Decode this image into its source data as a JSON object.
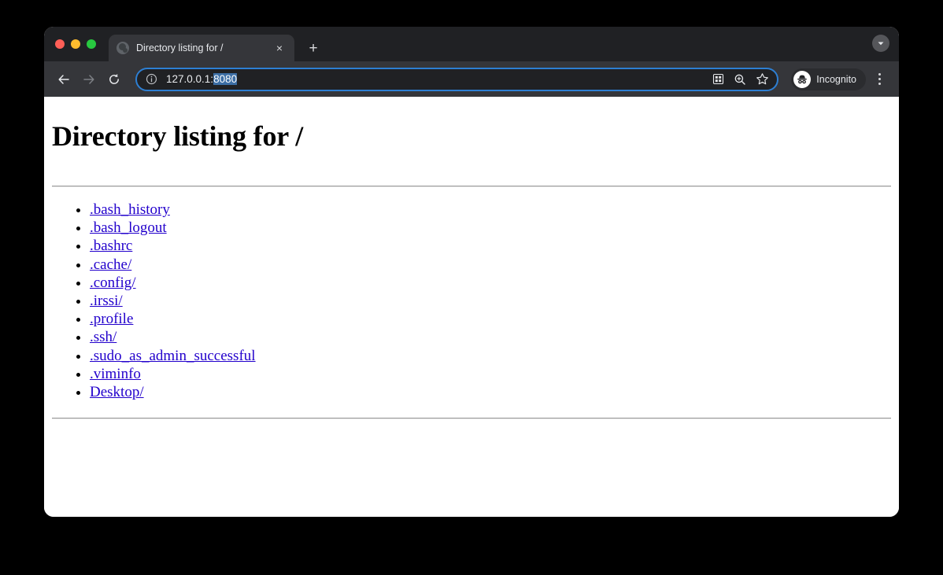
{
  "window": {
    "traffic_lights": [
      {
        "name": "close",
        "color": "#ff5f57"
      },
      {
        "name": "minimize",
        "color": "#febc2e"
      },
      {
        "name": "maximize",
        "color": "#28c840"
      }
    ]
  },
  "tabstrip": {
    "tab": {
      "title": "Directory listing for /",
      "favicon": "globe-icon",
      "close_label": "×"
    },
    "new_tab_label": "+",
    "tab_search_icon": "chevron-down-icon"
  },
  "toolbar": {
    "back_icon": "back-arrow-icon",
    "forward_icon": "forward-arrow-icon",
    "reload_icon": "reload-icon",
    "omnibox": {
      "site_info_icon": "info-circle-icon",
      "url_prefix": "127.0.0.1:",
      "url_selected": "8080",
      "full_url": "127.0.0.1:8080",
      "selection_color": "#3c6ea5",
      "focus_ring_color": "#2d7fd3",
      "share_icon": "qr-code-icon",
      "zoom_icon": "zoom-in-icon",
      "bookmark_icon": "star-icon"
    },
    "profile": {
      "label": "Incognito",
      "icon": "incognito-hat-glasses-icon"
    },
    "menu_icon": "three-dot-menu-icon"
  },
  "page": {
    "title": "Directory listing for /",
    "link_color": "#2200cc",
    "entries": [
      {
        "label": ".bash_history"
      },
      {
        "label": ".bash_logout"
      },
      {
        "label": ".bashrc"
      },
      {
        "label": ".cache/"
      },
      {
        "label": ".config/"
      },
      {
        "label": ".irssi/"
      },
      {
        "label": ".profile"
      },
      {
        "label": ".ssh/"
      },
      {
        "label": ".sudo_as_admin_successful"
      },
      {
        "label": ".viminfo"
      },
      {
        "label": "Desktop/"
      }
    ]
  }
}
